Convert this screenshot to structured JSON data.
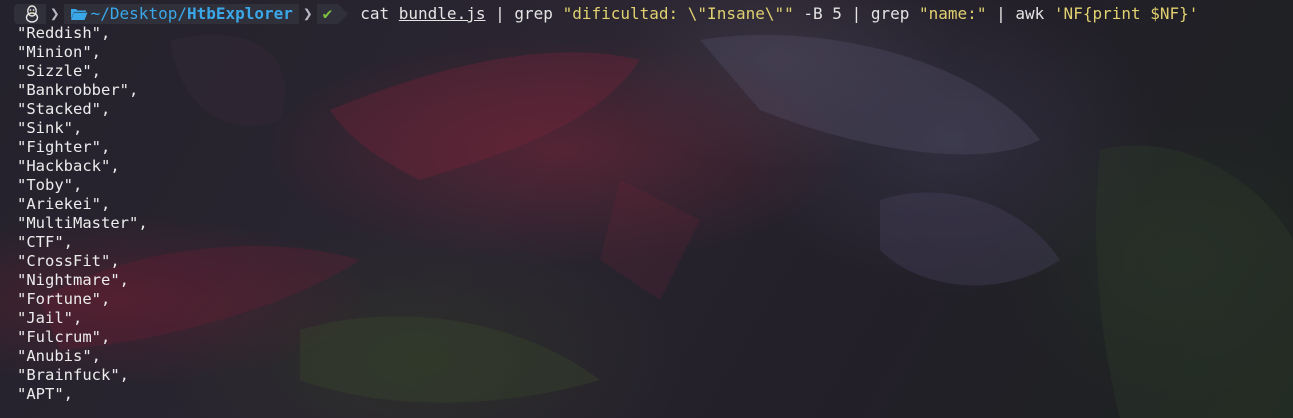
{
  "terminal": {
    "prompt": {
      "os_icon": "linux-tux-icon",
      "folder_icon": "folder-open-icon",
      "path_base": "~/Desktop/",
      "path_leaf": "HtbExplorer",
      "status_icon": "check-icon",
      "status_glyph": "✔"
    },
    "command": {
      "cmd1": "cat",
      "file": "bundle.js",
      "pipe1": "|",
      "cmd2": "grep",
      "pattern1": "\"dificultad: \\\"Insane\\\"\"",
      "flag": "-B 5",
      "pipe2": "|",
      "cmd3": "grep",
      "pattern2": "\"name:\"",
      "pipe3": "|",
      "cmd4": "awk",
      "awk_prog": "'NF{print $NF}'"
    },
    "output_lines": [
      "\"Reddish\",",
      "\"Minion\",",
      "\"Sizzle\",",
      "\"Bankrobber\",",
      "\"Stacked\",",
      "\"Sink\",",
      "\"Fighter\",",
      "\"Hackback\",",
      "\"Toby\",",
      "\"Ariekei\",",
      "\"MultiMaster\",",
      "\"CTF\",",
      "\"CrossFit\",",
      "\"Nightmare\",",
      "\"Fortune\",",
      "\"Jail\",",
      "\"Fulcrum\",",
      "\"Anubis\",",
      "\"Brainfuck\",",
      "\"APT\","
    ]
  },
  "colors": {
    "path": "#3aa7e8",
    "status_ok": "#7dc241",
    "string": "#e0d070",
    "text": "#ececec",
    "prompt_bg": "#30303a"
  }
}
